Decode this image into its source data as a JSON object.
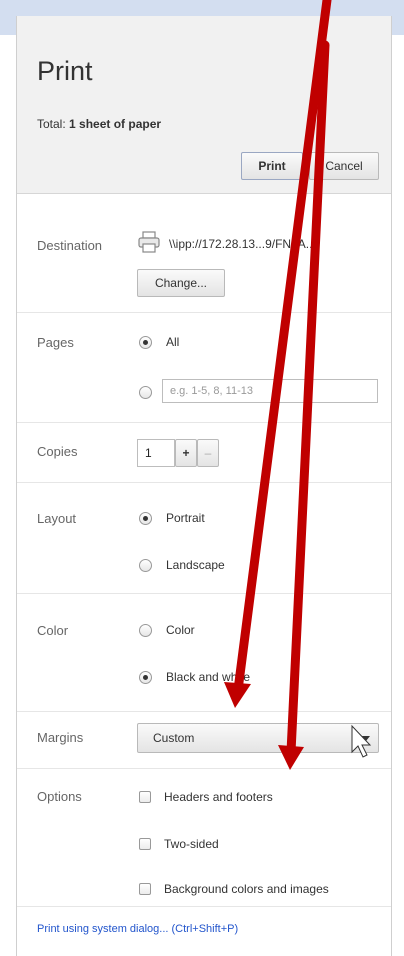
{
  "header": {
    "title": "Print",
    "total_prefix": "Total:",
    "total_value": "1 sheet of paper",
    "print_button": "Print",
    "cancel_button": "Cancel"
  },
  "destination": {
    "label": "Destination",
    "printer_icon": "printer-icon",
    "value": "\\\\ipp://172.28.13...9/FNLA...",
    "change_button": "Change..."
  },
  "pages": {
    "label": "Pages",
    "all_option": "All",
    "range_placeholder": "e.g. 1-5, 8, 11-13",
    "selected": "All"
  },
  "copies": {
    "label": "Copies",
    "value": "1",
    "plus": "+",
    "minus": "–"
  },
  "layout": {
    "label": "Layout",
    "options": [
      "Portrait",
      "Landscape"
    ],
    "selected": "Portrait"
  },
  "color": {
    "label": "Color",
    "options": [
      "Color",
      "Black and white"
    ],
    "selected": "Black and white"
  },
  "margins": {
    "label": "Margins",
    "value": "Custom",
    "dropdown_icon": "chevron-down-icon"
  },
  "options": {
    "label": "Options",
    "items": [
      "Headers and footers",
      "Two-sided",
      "Background colors and images"
    ]
  },
  "footer": {
    "system_dialog_link": "Print using system dialog... (Ctrl+Shift+P)"
  },
  "colors": {
    "header_bg": "#f1f1f1",
    "top_strip": "#d3def0",
    "arrow_red": "#cc0000",
    "link_blue": "#2255cc"
  }
}
